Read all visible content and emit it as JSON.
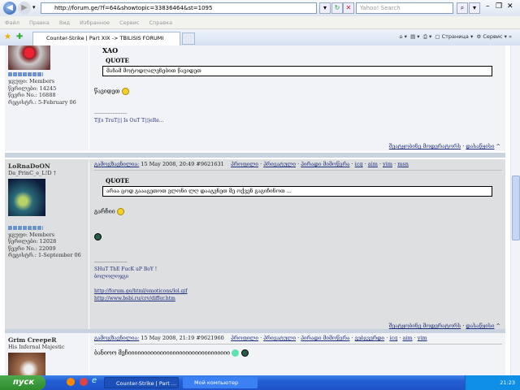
{
  "browser": {
    "url": "http://forum.ge/?f=64&showtopic=33836464&st=1095",
    "search_placeholder": "Yahoo! Search",
    "menu": [
      "Файл",
      "Правка",
      "Вид",
      "Избранное",
      "Сервис",
      "Справка"
    ],
    "tab_title": "Counter-Strike | Part XIX -> TBILISIS FORUMI",
    "cmd": {
      "page": "Страница",
      "tools": "Сервис"
    }
  },
  "posts": [
    {
      "username": "XAO",
      "quote_label": "QUOTE",
      "quote": "მანამ მოტოდღალენებით წავიდეთ",
      "body": "წავიდეთ",
      "sig_line": "--------------------",
      "sig": "T|[s TruT|¦| Is OuT T|¦|eRe...",
      "group": "ჯგუფი: Members",
      "posts_count": "წერილები: 14245",
      "member_no": "წევრი No.: 16888",
      "joined": "რეგისტრ.: 5-February 06",
      "footer": {
        "report": "შეატყობინე მოდერატორს",
        "top": "დასაწყისი"
      }
    },
    {
      "username": "LoRnaDoON",
      "title": "Da_PrinC_e_L!D †",
      "meta_label": "გამოგზავნილია:",
      "date": "15 May 2008, 20:49",
      "post_id": "#9621631",
      "actions": [
        "პროფილი",
        "პრივატული",
        "პირადი მიმოწერა",
        "icq",
        "aim",
        "yim",
        "msn"
      ],
      "quote_label": "QUOTE",
      "quote": "არაა ცოდ გაააგეთოთ ვლონი ლღ დააგენეთ მე ოქვენ გაგიჩინოთ ...",
      "body": "გარჩიი",
      "sig_line": "--------------------",
      "sig1": "SHuT ThE FucK uP BoY !",
      "sig2": "ბოლოლოჯგი",
      "link1": "http://forum.ge/html/emoticons/lol.gif",
      "link2": "http://www.bsbi.ru/crv/differ.htm",
      "group": "ჯგუფი: Members",
      "posts_count": "წერილები: 12028",
      "member_no": "წევრი No.: 22009",
      "joined": "რეგისტრ.: 1-September 06",
      "footer": {
        "report": "შეატყობინე მოდერატორს",
        "top": "დასაწყისი"
      }
    },
    {
      "username": "Grim CreepeR",
      "title": "His Infernal Majestic",
      "meta_label": "გამოგზავნილია:",
      "date": "15 May 2008, 21:19",
      "post_id": "#9621960",
      "actions": [
        "პროფილი",
        "პრივატული",
        "პირადი მიმოწერა",
        "ვებგვერდი",
        "icq",
        "aim",
        "yim"
      ],
      "body": "ბანიოო მეჩიიიიიიიიიიიიიიიიიიიიიიიიიიიიიიიი"
    }
  ],
  "taskbar": {
    "start": "пуск",
    "tasks": [
      "Counter-Strike | Part ...",
      "Мой компьютер"
    ],
    "clock": "21:23"
  }
}
